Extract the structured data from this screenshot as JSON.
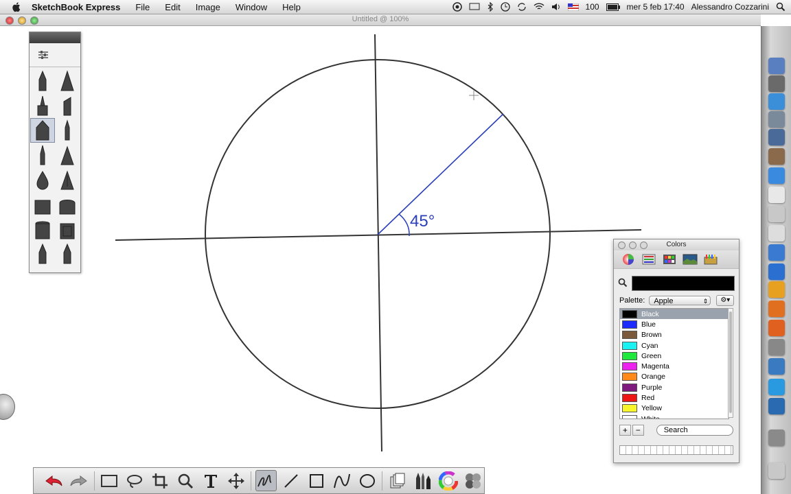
{
  "menubar": {
    "app_name": "SketchBook Express",
    "menus": [
      "File",
      "Edit",
      "Image",
      "Window",
      "Help"
    ],
    "battery": "100",
    "datetime": "mer 5 feb  17:40",
    "user": "Alessandro Cozzarini"
  },
  "window": {
    "title": "Untitled @ 100%"
  },
  "canvas": {
    "angle_label": "45°"
  },
  "brush_palette": {
    "brushes": [
      "pencil",
      "ink-pen",
      "marker",
      "chisel-marker",
      "airbrush",
      "fine-pen",
      "felt-pen",
      "triangle-brush",
      "water-drop",
      "smudge",
      "eraser-hard",
      "eraser-soft",
      "paint-bucket",
      "fill-bucket",
      "brush-pen",
      "nib-pen"
    ],
    "selected_index": 4
  },
  "colors_panel": {
    "title": "Colors",
    "palette_label": "Palette:",
    "palette_value": "Apple",
    "search_placeholder": "Search",
    "add_label": "+",
    "remove_label": "−",
    "colors": [
      {
        "name": "Black",
        "hex": "#000000"
      },
      {
        "name": "Blue",
        "hex": "#1e2cff"
      },
      {
        "name": "Brown",
        "hex": "#7a5a3a"
      },
      {
        "name": "Cyan",
        "hex": "#19f2f2"
      },
      {
        "name": "Green",
        "hex": "#1fe83c"
      },
      {
        "name": "Magenta",
        "hex": "#ee22ee"
      },
      {
        "name": "Orange",
        "hex": "#ff8a1a"
      },
      {
        "name": "Purple",
        "hex": "#7f1a7f"
      },
      {
        "name": "Red",
        "hex": "#ee1515"
      },
      {
        "name": "Yellow",
        "hex": "#f6f62a"
      },
      {
        "name": "White",
        "hex": "#ffffff"
      }
    ],
    "selected_index": 0,
    "current_color": "#000000"
  },
  "toolbar": {
    "tools": [
      "undo",
      "redo",
      "rectangle-select",
      "lasso-select",
      "crop",
      "zoom",
      "text",
      "move",
      "pencil-tool",
      "line",
      "rectangle",
      "curve",
      "ellipse",
      "layers",
      "brushes",
      "color-wheel",
      "swatches"
    ],
    "selected": "pencil-tool"
  }
}
